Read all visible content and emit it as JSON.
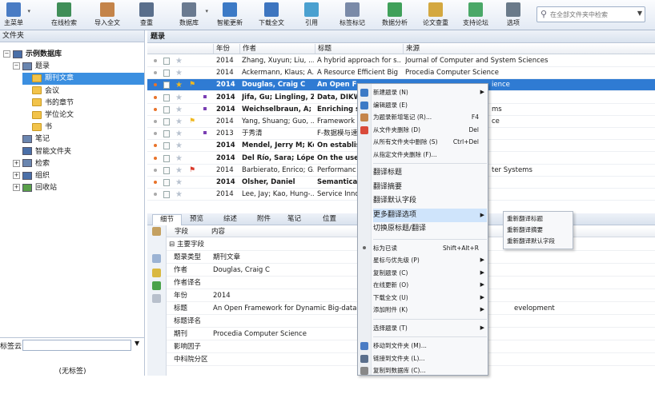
{
  "toolbar": {
    "buttons": [
      {
        "label": "主菜单",
        "icon": "main-menu-icon"
      },
      {
        "label": "在线检索",
        "icon": "online-search-icon"
      },
      {
        "label": "导入全文",
        "icon": "import-fulltext-icon"
      },
      {
        "label": "查重",
        "icon": "duplicate-check-icon"
      },
      {
        "label": "数据库",
        "icon": "database-icon"
      },
      {
        "label": "智能更新",
        "icon": "smart-update-icon"
      },
      {
        "label": "下载全文",
        "icon": "download-fulltext-icon"
      },
      {
        "label": "引用",
        "icon": "cite-icon"
      },
      {
        "label": "标签标记",
        "icon": "tag-mark-icon"
      },
      {
        "label": "数据分析",
        "icon": "data-analysis-icon"
      },
      {
        "label": "论文查重",
        "icon": "paper-check-icon"
      },
      {
        "label": "支持论坛",
        "icon": "forum-icon"
      },
      {
        "label": "选项",
        "icon": "options-icon"
      }
    ],
    "search_placeholder": "在全部文件夹中检索"
  },
  "left": {
    "header": "文件夹",
    "tree": [
      {
        "label": "示例数据库",
        "level": 0,
        "bold": true,
        "exp": "−"
      },
      {
        "label": "题录",
        "level": 1,
        "exp": "−"
      },
      {
        "label": "期刊文章",
        "level": 2,
        "selected": true
      },
      {
        "label": "会议",
        "level": 2
      },
      {
        "label": "书的章节",
        "level": 2
      },
      {
        "label": "学位论文",
        "level": 2
      },
      {
        "label": "书",
        "level": 2
      },
      {
        "label": "笔记",
        "level": 1
      },
      {
        "label": "智能文件夹",
        "level": 1
      },
      {
        "label": "检索",
        "level": 1,
        "exp": "+"
      },
      {
        "label": "组织",
        "level": 1,
        "exp": "+"
      },
      {
        "label": "回收站",
        "level": 1,
        "exp": "+"
      }
    ],
    "tag_label": "标签云",
    "tag_empty": "(无标签)"
  },
  "list": {
    "header": "题录",
    "columns": {
      "year": "年份",
      "author": "作者",
      "title": "标题",
      "source": "来源"
    },
    "rows": [
      {
        "year": "2014",
        "author": "Zhang, Xuyun; Liu, ...",
        "title": "A hybrid approach for s...",
        "source": "Journal of Computer and System Sciences",
        "bold": false,
        "star": false,
        "flag": "",
        "dot": "g"
      },
      {
        "year": "2014",
        "author": "Ackermann, Klaus; A...",
        "title": "A Resource Efficient Big ...",
        "source": "Procedia Computer Science",
        "bold": false,
        "star": false,
        "flag": "",
        "dot": "g"
      },
      {
        "year": "2014",
        "author": "Douglas, Craig C",
        "title": "An Open F",
        "source": "ience",
        "bold": true,
        "star": true,
        "flag": "y",
        "dot": "o",
        "sel": true
      },
      {
        "year": "2014",
        "author": "Jifa, Gu; Lingling, Zh",
        "title": "Data, DIKW",
        "source": "",
        "bold": true,
        "star": false,
        "flag": "",
        "dot": "o",
        "mark": true
      },
      {
        "year": "2014",
        "author": "Weichselbraun, A; G",
        "title": "Enriching s",
        "source": "ms",
        "bold": true,
        "star": false,
        "flag": "",
        "dot": "o",
        "mark": true
      },
      {
        "year": "2014",
        "author": "Yang, Shuang; Guo, ...",
        "title": "Framework",
        "source": "ce",
        "bold": false,
        "star": false,
        "flag": "y",
        "dot": "g"
      },
      {
        "year": "2013",
        "author": "于秀清",
        "title": "F-数据模与速",
        "source": "",
        "bold": false,
        "star": false,
        "flag": "",
        "dot": "g",
        "mark": true
      },
      {
        "year": "2014",
        "author": "Mendel, Jerry M; Ko",
        "title": "On establis",
        "source": "",
        "bold": true,
        "star": false,
        "flag": "",
        "dot": "o"
      },
      {
        "year": "2014",
        "author": "Del Río, Sara; López",
        "title": "On the use",
        "source": "",
        "bold": true,
        "star": false,
        "flag": "",
        "dot": "o"
      },
      {
        "year": "2014",
        "author": "Barbierato, Enrico; G...",
        "title": "Performanc",
        "source": "ter Systems",
        "bold": false,
        "star": false,
        "flag": "r",
        "dot": "g"
      },
      {
        "year": "2014",
        "author": "Olsher, Daniel",
        "title": "Semantical",
        "source": "",
        "bold": true,
        "star": false,
        "flag": "",
        "dot": "o"
      },
      {
        "year": "2014",
        "author": "Lee, Jay; Kao, Hung-...",
        "title": "Service Inno",
        "source": "",
        "bold": false,
        "star": false,
        "flag": "",
        "dot": "g"
      }
    ]
  },
  "details": {
    "tabs": [
      "细节",
      "预览",
      "综述",
      "附件",
      "笔记",
      "位置"
    ],
    "field_header": "字段",
    "content_header": "内容",
    "section": "主要字段",
    "fields": [
      {
        "name": "题录类型",
        "value": "期刊文章"
      },
      {
        "name": "作者",
        "value": "Douglas, Craig C"
      },
      {
        "name": "作者译名",
        "value": ""
      },
      {
        "name": "年份",
        "value": "2014"
      },
      {
        "name": "标题",
        "value": "An Open Framework for Dynamic Big-data-d"
      },
      {
        "name": "标题译名",
        "value": ""
      },
      {
        "name": "期刊",
        "value": "Procedia Computer Science"
      },
      {
        "name": "影响因子",
        "value": ""
      },
      {
        "name": "中科院分区",
        "value": ""
      }
    ],
    "title_tail": "evelopment"
  },
  "context_menu": {
    "items": [
      {
        "label": "新建题录 (N)",
        "arrow": true,
        "icon": true
      },
      {
        "label": "编辑题录 (E)",
        "icon": true
      },
      {
        "label": "为题录新增笔记 (R)...",
        "shortcut": "F4",
        "icon": true
      },
      {
        "label": "从文件夹删除 (D)",
        "shortcut": "Del",
        "icon": true
      },
      {
        "label": "从所有文件夹中删除 (S)",
        "shortcut": "Ctrl+Del"
      },
      {
        "label": "从指定文件夹删除 (F)..."
      },
      {
        "sep": true
      },
      {
        "label": "翻译标题",
        "big": true
      },
      {
        "label": "翻译摘要",
        "big": true
      },
      {
        "label": "翻译默认字段",
        "big": true
      },
      {
        "label": "更多翻译选项",
        "big": true,
        "arrow": true,
        "hl": true
      },
      {
        "label": "切换原标题/翻译",
        "big": true
      },
      {
        "sep": true
      },
      {
        "label": "标为已读",
        "shortcut": "Shift+Alt+R",
        "dot": true
      },
      {
        "label": "星标与优先级 (P)",
        "arrow": true
      },
      {
        "label": "复制题录 (C)",
        "arrow": true
      },
      {
        "label": "在线更新 (O)",
        "arrow": true
      },
      {
        "label": "下载全文 (U)",
        "arrow": true
      },
      {
        "label": "添加附件 (K)",
        "arrow": true
      },
      {
        "sep": true
      },
      {
        "label": "选择题录 (T)",
        "arrow": true
      },
      {
        "sep": true
      },
      {
        "label": "移动到文件夹 (M)...",
        "icon": true
      },
      {
        "label": "链接到文件夹 (L)...",
        "icon": true
      },
      {
        "label": "复制到数据库 (C)...",
        "icon": true
      }
    ],
    "submenu": [
      "重新翻译标题",
      "重新翻译摘要",
      "重新翻译默认字段"
    ]
  },
  "colors": {
    "accent": "#2f7bd3",
    "folder": "#f2c34a",
    "flag_yellow": "#f0b820",
    "flag_red": "#d93a2b",
    "unread": "#e8732a"
  }
}
